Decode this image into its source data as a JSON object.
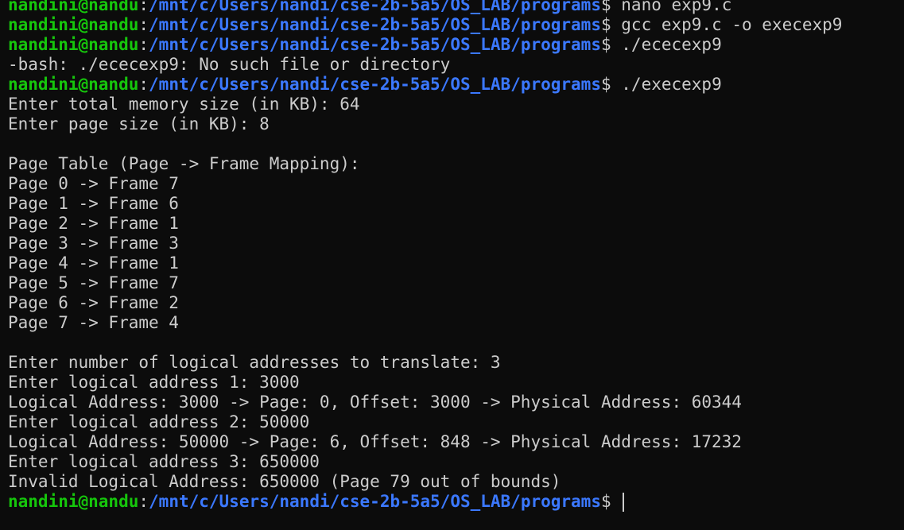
{
  "prompt": {
    "user_host": "nandini@nandu",
    "colon": ":",
    "path": "/mnt/c/Users/nandi/cse-2b-5a5/OS_LAB/programs",
    "dollar": "$ "
  },
  "lines": [
    {
      "type": "prompt",
      "command": "nano exp9.c"
    },
    {
      "type": "prompt",
      "command": "gcc exp9.c -o execexp9"
    },
    {
      "type": "prompt",
      "command": "./ececexp9"
    },
    {
      "type": "output",
      "text": "-bash: ./ececexp9: No such file or directory"
    },
    {
      "type": "prompt",
      "command": "./execexp9"
    },
    {
      "type": "output",
      "text": "Enter total memory size (in KB): 64"
    },
    {
      "type": "output",
      "text": "Enter page size (in KB): 8"
    },
    {
      "type": "output",
      "text": ""
    },
    {
      "type": "output",
      "text": "Page Table (Page -> Frame Mapping):"
    },
    {
      "type": "output",
      "text": "Page 0 -> Frame 7"
    },
    {
      "type": "output",
      "text": "Page 1 -> Frame 6"
    },
    {
      "type": "output",
      "text": "Page 2 -> Frame 1"
    },
    {
      "type": "output",
      "text": "Page 3 -> Frame 3"
    },
    {
      "type": "output",
      "text": "Page 4 -> Frame 1"
    },
    {
      "type": "output",
      "text": "Page 5 -> Frame 7"
    },
    {
      "type": "output",
      "text": "Page 6 -> Frame 2"
    },
    {
      "type": "output",
      "text": "Page 7 -> Frame 4"
    },
    {
      "type": "output",
      "text": ""
    },
    {
      "type": "output",
      "text": "Enter number of logical addresses to translate: 3"
    },
    {
      "type": "output",
      "text": "Enter logical address 1: 3000"
    },
    {
      "type": "output",
      "text": "Logical Address: 3000 -> Page: 0, Offset: 3000 -> Physical Address: 60344"
    },
    {
      "type": "output",
      "text": "Enter logical address 2: 50000"
    },
    {
      "type": "output",
      "text": "Logical Address: 50000 -> Page: 6, Offset: 848 -> Physical Address: 17232"
    },
    {
      "type": "output",
      "text": "Enter logical address 3: 650000"
    },
    {
      "type": "output",
      "text": "Invalid Logical Address: 650000 (Page 79 out of bounds)"
    },
    {
      "type": "prompt",
      "command": "",
      "cursor": true
    }
  ],
  "colors": {
    "background": "#0c0c0c",
    "foreground": "#cccccc",
    "prompt_user": "#16c60c",
    "prompt_path": "#3b78ff"
  }
}
